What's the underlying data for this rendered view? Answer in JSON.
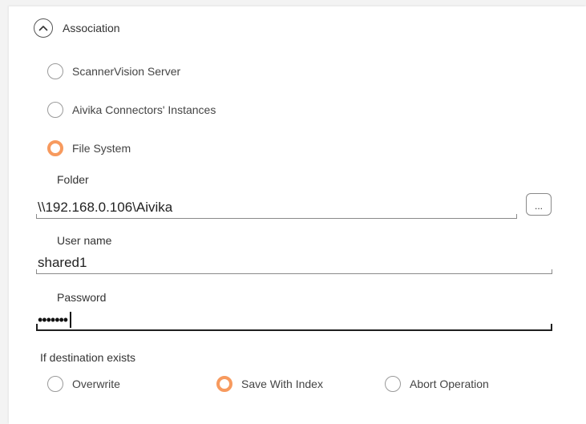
{
  "section": {
    "title": "Association",
    "toggle_icon": "chevron-up-icon"
  },
  "association": {
    "options": [
      {
        "label": "ScannerVision Server",
        "checked": false
      },
      {
        "label": "Aivika Connectors' Instances",
        "checked": false
      },
      {
        "label": "File System",
        "checked": true
      }
    ]
  },
  "folder": {
    "label": "Folder",
    "value": "\\\\192.168.0.106\\Aivika",
    "browse_label": "..."
  },
  "username": {
    "label": "User name",
    "value": "shared1"
  },
  "password": {
    "label": "Password",
    "masked_value": "•••••••"
  },
  "destination": {
    "label": "If destination exists",
    "options": [
      {
        "label": "Overwrite",
        "checked": false
      },
      {
        "label": "Save With Index",
        "checked": true
      },
      {
        "label": "Abort Operation",
        "checked": false
      }
    ]
  },
  "colors": {
    "accent": "#f79a5e",
    "radio_border": "#9a9a9a",
    "text": "#333333",
    "background": "#f3f3f3",
    "panel": "#ffffff"
  }
}
